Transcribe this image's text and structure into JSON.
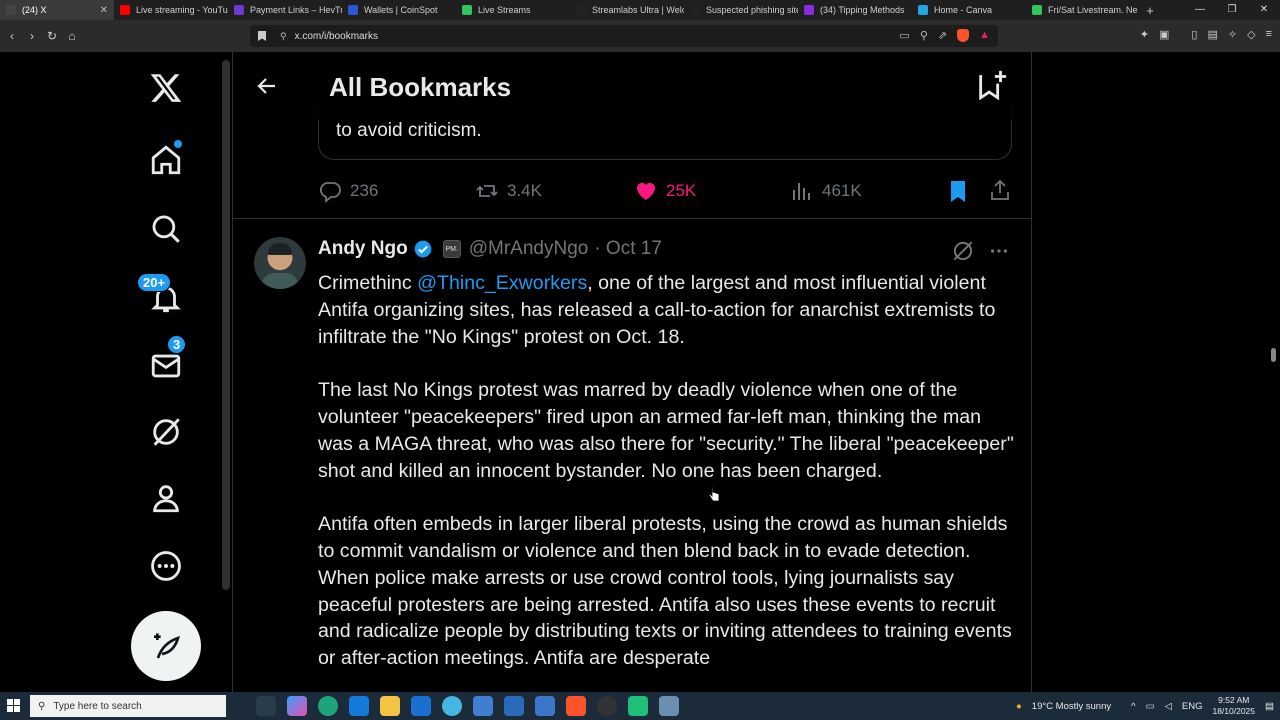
{
  "browser": {
    "tabs": [
      {
        "label": "(24) X",
        "color": "#444444",
        "active": true
      },
      {
        "label": "Live streaming - YouTube",
        "color": "#ff0000"
      },
      {
        "label": "Payment Links – HevTr",
        "color": "#6c3bd1"
      },
      {
        "label": "Wallets | CoinSpot",
        "color": "#2b57d6"
      },
      {
        "label": "Live Streams",
        "color": "#31c75a"
      },
      {
        "label": "Streamlabs Ultra | Welc",
        "color": "#222222"
      },
      {
        "label": "Suspected phishing site",
        "color": "#222222"
      },
      {
        "label": "(34) Tipping Methods",
        "color": "#8a2be2"
      },
      {
        "label": "Home - Canva",
        "color": "#20a6e0"
      },
      {
        "label": "Fri/Sat Livestream. Ne",
        "color": "#31c75a"
      }
    ],
    "new_tab": "+",
    "url": "x.com/i/bookmarks"
  },
  "sidebar": {
    "notifications_badge": "20+",
    "messages_badge": "3"
  },
  "header": {
    "title": "All Bookmarks"
  },
  "previous_tweet": {
    "quote_text": "to avoid criticism.",
    "replies": "236",
    "reposts": "3.4K",
    "likes": "25K",
    "views": "461K"
  },
  "tweet": {
    "author_name": "Andy Ngo",
    "affiliate_badge": "PM.",
    "handle": "@MrAndyNgo",
    "date": "· Oct 17",
    "para1_a": "Crimethinc ",
    "para1_mention": "@Thinc_Exworkers",
    "para1_b": ", one of the largest and most influential violent Antifa organizing sites, has released a call-to-action for anarchist extremists to infiltrate the \"No Kings\" protest on Oct. 18.",
    "para2": "The last No Kings protest was marred by deadly violence when one of the volunteer \"peacekeepers\" fired upon an armed far-left man, thinking the man was a MAGA threat, who was also there for \"security.\" The liberal \"peacekeeper\" shot and killed an innocent bystander. No one has been charged.",
    "para3": "Antifa often embeds in larger liberal protests, using the crowd as human shields to commit vandalism or violence and then blend back in to evade detection. When police make arrests or use crowd control tools, lying journalists say peaceful protesters are being arrested. Antifa also uses these events to recruit and radicalize people by distributing texts or inviting attendees to training events or after-action meetings. Antifa are desperate"
  },
  "taskbar": {
    "search_placeholder": "Type here to search",
    "weather": "19°C  Mostly sunny",
    "lang": "ENG",
    "time": "9:52 AM",
    "date": "18/10/2025"
  }
}
